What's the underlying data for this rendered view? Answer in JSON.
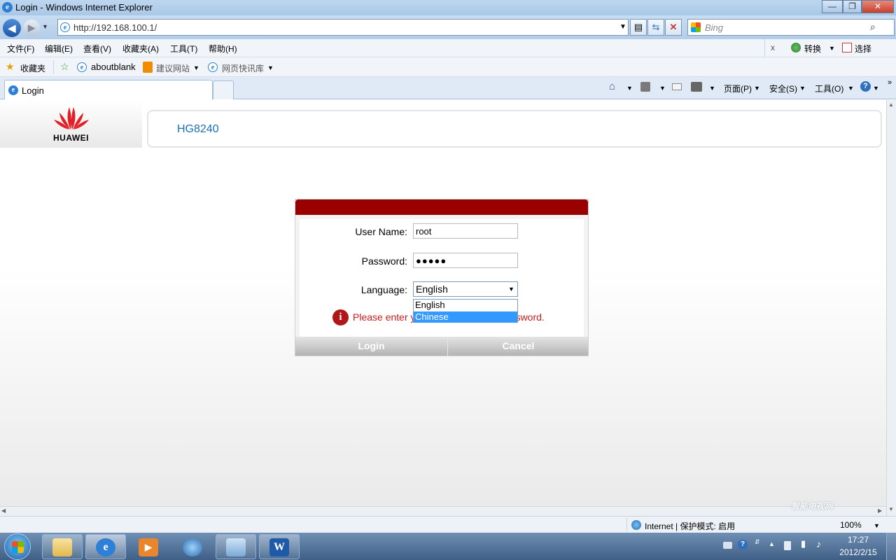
{
  "window": {
    "title": "Login - Windows Internet Explorer",
    "minimize": "—",
    "maximize": "❐",
    "close": "✕"
  },
  "address": {
    "url": "http://192.168.100.1/",
    "search_placeholder": "Bing"
  },
  "menu": [
    "文件(F)",
    "编辑(E)",
    "查看(V)",
    "收藏夹(A)",
    "工具(T)",
    "帮助(H)"
  ],
  "toolbar_right": {
    "close": "x",
    "convert": "转换",
    "select": "选择"
  },
  "favorites": {
    "label": "收藏夹",
    "items": [
      "aboutblank",
      "建议网站",
      "网页快讯库"
    ]
  },
  "tab": {
    "label": "Login"
  },
  "command_bar": {
    "page": "页面(P)",
    "safety": "安全(S)",
    "tools": "工具(O)"
  },
  "page": {
    "brand": "HUAWEI",
    "model": "HG8240",
    "username_label": "User Name:",
    "username_value": "root",
    "password_label": "Password:",
    "password_masked": "●●●●●",
    "language_label": "Language:",
    "language_selected": "English",
    "language_options": [
      "English",
      "Chinese"
    ],
    "error_left": "Please enter y",
    "error_right": "password.",
    "login_button": "Login",
    "cancel_button": "Cancel"
  },
  "statusbar": {
    "zone": "Internet | 保护模式: 启用",
    "zoom": "100%"
  },
  "watermark": "智能电视网",
  "taskbar": {
    "time": "17:27",
    "date": "2012/2/15"
  },
  "colors": {
    "brand_red": "#990000",
    "error_red": "#cc1a1a",
    "model_blue": "#1a6fb0",
    "selection": "#3399ff"
  }
}
